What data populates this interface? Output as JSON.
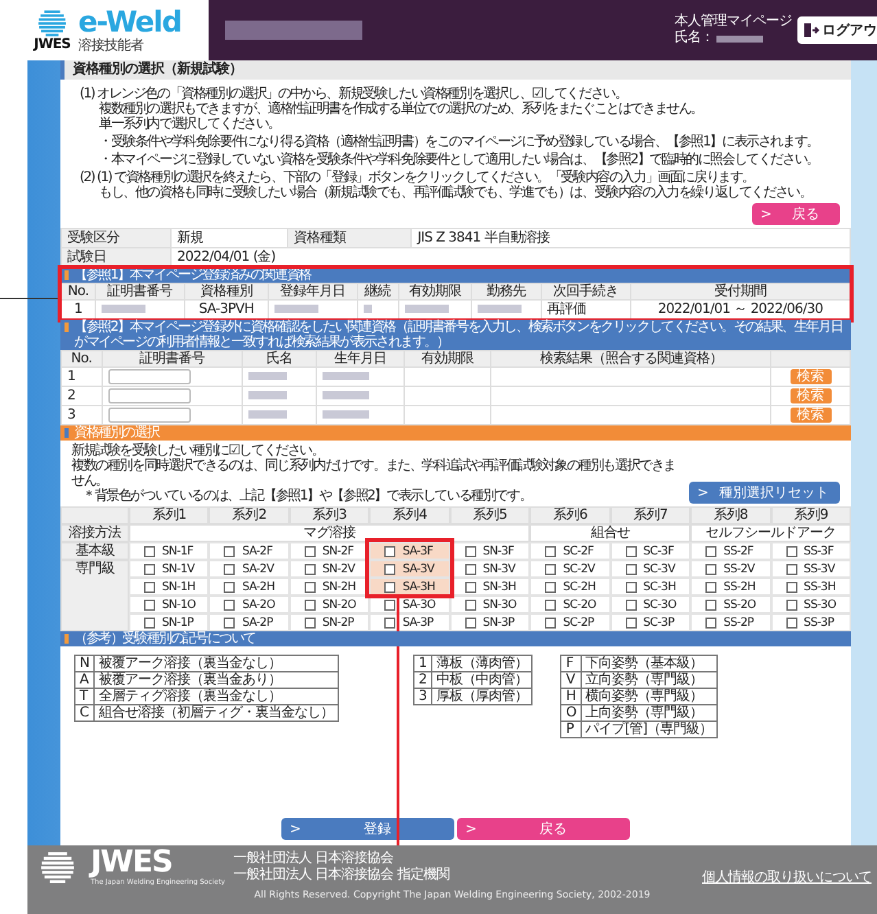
{
  "header": {
    "logo_org": "JWES",
    "logo_title": "e-Weld",
    "logo_subtitle": "溶接技能者",
    "mypage": "本人管理マイページ",
    "name_label": "氏名：",
    "logout": "ログアウ"
  },
  "section_title": "資格種別の選択（新規試験）",
  "instructions": [
    {
      "kind": "para",
      "text": "(1) オレンジ色の「資格種別の選択」の中から、新規受験したい資格種別を選択し、☑してください。"
    },
    {
      "kind": "cont",
      "text": "複数種別の選択もできますが、適格性証明書を作成する単位での選択のため、系列をまたぐことはできません。"
    },
    {
      "kind": "cont",
      "text": "単一系列内で選択してください。"
    },
    {
      "kind": "bullet",
      "text": "・受験条件や学科免除要件になり得る資格（適格性証明書）をこのマイページに予め登録している場合、【参照1】に表示されます。"
    },
    {
      "kind": "bullet",
      "text": "・本マイページに登録していない資格を受験条件や学科免除要件として適用したい場合は、【参照2】で臨時的に照会してください。"
    },
    {
      "kind": "para",
      "text": "(2) (1) で資格種別の選択を終えたら、下部の「登録」ボタンをクリックしてください。「受験内容の入力」画面に戻ります。"
    },
    {
      "kind": "cont",
      "text": "もし、他の資格も同時に受験したい場合（新規試験でも、再評価試験でも、学進でも）は、受験内容の入力を繰り返してください。"
    }
  ],
  "back_button": {
    "glyph": ">",
    "label": "戻る"
  },
  "info": [
    {
      "label": "受験区分",
      "value": "新規",
      "label2": "資格種類",
      "value2": "JIS Z 3841 半自動溶接"
    },
    {
      "label": "試験日",
      "value": "2022/04/01 (金)"
    }
  ],
  "reference1": {
    "title": "【参照1】本マイページ登録済みの関連資格",
    "columns": [
      "No.",
      "証明書番号",
      "資格種別",
      "登録年月日",
      "継続",
      "有効期限",
      "勤務先",
      "次回手続き",
      "受付期間"
    ],
    "rows": [
      [
        {
          "text": "1"
        },
        {
          "redacted": true
        },
        {
          "text": "SA-3PVH"
        },
        {
          "redacted": true
        },
        {
          "redacted": true
        },
        {
          "redacted": true
        },
        {
          "redacted": true
        },
        {
          "text": "再評価"
        },
        {
          "text": "2022/01/01 ～ 2022/06/30"
        }
      ]
    ]
  },
  "reference2": {
    "title": "【参照2】本マイページ登録外に資格確認をしたい関連資格（証明書番号を入力し、検索ボタンをクリックしてください。その結果、生年月日がマイページの利用者情報と一致すれば検索結果が表示されます。）",
    "columns": [
      "No.",
      "証明書番号",
      "氏名",
      "生年月日",
      "有効期限",
      "検索結果（照合する関連資格）"
    ],
    "rows": [
      {
        "no": "1",
        "button": "検索"
      },
      {
        "no": "2",
        "button": "検索"
      },
      {
        "no": "3",
        "button": "検索"
      }
    ]
  },
  "selection": {
    "title": "資格種別の選択",
    "notes": [
      "新規試験を受験したい種別に☑してください。",
      "複数の種別を同時選択できるのは、同じ系列内だけです。また、学科追試や再評価試験対象の種別も選択できません。",
      "＊背景色がついているのは、上記【参照1】や【参照2】で表示している種別です。"
    ],
    "reset_button": {
      "glyph": ">",
      "label": "種別選択リセット"
    },
    "method_label": "溶接方法",
    "basic_label": "基本級",
    "advanced_label": "専門級",
    "methods": [
      {
        "label": "マグ溶接",
        "series": [
          {
            "label": "系列1",
            "basic": {
              "code": "SN-1F",
              "checked": false,
              "highlighted": false
            },
            "advanced": [
              {
                "code": "SN-1V",
                "checked": false,
                "highlighted": false
              },
              {
                "code": "SN-1H",
                "checked": false,
                "highlighted": false
              },
              {
                "code": "SN-1O",
                "checked": false,
                "highlighted": false
              },
              {
                "code": "SN-1P",
                "checked": false,
                "highlighted": false
              }
            ]
          },
          {
            "label": "系列2",
            "basic": {
              "code": "SA-2F",
              "checked": false,
              "highlighted": false
            },
            "advanced": [
              {
                "code": "SA-2V",
                "checked": false,
                "highlighted": false
              },
              {
                "code": "SA-2H",
                "checked": false,
                "highlighted": false
              },
              {
                "code": "SA-2O",
                "checked": false,
                "highlighted": false
              },
              {
                "code": "SA-2P",
                "checked": false,
                "highlighted": false
              }
            ]
          },
          {
            "label": "系列3",
            "basic": {
              "code": "SN-2F",
              "checked": false,
              "highlighted": false
            },
            "advanced": [
              {
                "code": "SN-2V",
                "checked": false,
                "highlighted": false
              },
              {
                "code": "SN-2H",
                "checked": false,
                "highlighted": false
              },
              {
                "code": "SN-2O",
                "checked": false,
                "highlighted": false
              },
              {
                "code": "SN-2P",
                "checked": false,
                "highlighted": false
              }
            ]
          },
          {
            "label": "系列4",
            "basic": {
              "code": "SA-3F",
              "checked": false,
              "highlighted": true
            },
            "advanced": [
              {
                "code": "SA-3V",
                "checked": false,
                "highlighted": true
              },
              {
                "code": "SA-3H",
                "checked": false,
                "highlighted": true
              },
              {
                "code": "SA-3O",
                "checked": false,
                "highlighted": false
              },
              {
                "code": "SA-3P",
                "checked": false,
                "highlighted": false
              }
            ]
          },
          {
            "label": "系列5",
            "basic": {
              "code": "SN-3F",
              "checked": false,
              "highlighted": false
            },
            "advanced": [
              {
                "code": "SN-3V",
                "checked": false,
                "highlighted": false
              },
              {
                "code": "SN-3H",
                "checked": false,
                "highlighted": false
              },
              {
                "code": "SN-3O",
                "checked": false,
                "highlighted": false
              },
              {
                "code": "SN-3P",
                "checked": false,
                "highlighted": false
              }
            ]
          }
        ]
      },
      {
        "label": "組合せ",
        "series": [
          {
            "label": "系列6",
            "basic": {
              "code": "SC-2F",
              "checked": false,
              "highlighted": false
            },
            "advanced": [
              {
                "code": "SC-2V",
                "checked": false,
                "highlighted": false
              },
              {
                "code": "SC-2H",
                "checked": false,
                "highlighted": false
              },
              {
                "code": "SC-2O",
                "checked": false,
                "highlighted": false
              },
              {
                "code": "SC-2P",
                "checked": false,
                "highlighted": false
              }
            ]
          },
          {
            "label": "系列7",
            "basic": {
              "code": "SC-3F",
              "checked": false,
              "highlighted": false
            },
            "advanced": [
              {
                "code": "SC-3V",
                "checked": false,
                "highlighted": false
              },
              {
                "code": "SC-3H",
                "checked": false,
                "highlighted": false
              },
              {
                "code": "SC-3O",
                "checked": false,
                "highlighted": false
              },
              {
                "code": "SC-3P",
                "checked": false,
                "highlighted": false
              }
            ]
          }
        ]
      },
      {
        "label": "セルフシールドアーク",
        "series": [
          {
            "label": "系列8",
            "basic": {
              "code": "SS-2F",
              "checked": false,
              "highlighted": false
            },
            "advanced": [
              {
                "code": "SS-2V",
                "checked": false,
                "highlighted": false
              },
              {
                "code": "SS-2H",
                "checked": false,
                "highlighted": false
              },
              {
                "code": "SS-2O",
                "checked": false,
                "highlighted": false
              },
              {
                "code": "SS-2P",
                "checked": false,
                "highlighted": false
              }
            ]
          },
          {
            "label": "系列9",
            "basic": {
              "code": "SS-3F",
              "checked": false,
              "highlighted": false
            },
            "advanced": [
              {
                "code": "SS-3V",
                "checked": false,
                "highlighted": false
              },
              {
                "code": "SS-3H",
                "checked": false,
                "highlighted": false
              },
              {
                "code": "SS-3O",
                "checked": false,
                "highlighted": false
              },
              {
                "code": "SS-3P",
                "checked": false,
                "highlighted": false
              }
            ]
          }
        ]
      }
    ]
  },
  "legend": {
    "title": "（参考）受験種別の記号について",
    "tables": [
      [
        {
          "symbol": "N",
          "meaning": "被覆アーク溶接（裏当金なし）"
        },
        {
          "symbol": "A",
          "meaning": "被覆アーク溶接（裏当金あり）"
        },
        {
          "symbol": "T",
          "meaning": "全層ティグ溶接（裏当金なし）"
        },
        {
          "symbol": "C",
          "meaning": "組合せ溶接（初層ティグ・裏当金なし）"
        }
      ],
      [
        {
          "symbol": "1",
          "meaning": "薄板（薄肉管）"
        },
        {
          "symbol": "2",
          "meaning": "中板（中肉管）"
        },
        {
          "symbol": "3",
          "meaning": "厚板（厚肉管）"
        }
      ],
      [
        {
          "symbol": "F",
          "meaning": "下向姿勢（基本級）"
        },
        {
          "symbol": "V",
          "meaning": "立向姿勢（専門級）"
        },
        {
          "symbol": "H",
          "meaning": "横向姿勢（専門級）"
        },
        {
          "symbol": "O",
          "meaning": "上向姿勢（専門級）"
        },
        {
          "symbol": "P",
          "meaning": "パイプ[管]（専門級）"
        }
      ]
    ]
  },
  "actions": [
    {
      "kind": "primary",
      "glyph": ">",
      "label": "登録"
    },
    {
      "kind": "secondary",
      "glyph": ">",
      "label": "戻る"
    }
  ],
  "footer": {
    "logo": "JWES",
    "tagline": "The Japan Welding Engineering Society",
    "lines": [
      "一般社団法人 日本溶接協会",
      "一般社団法人 日本溶接協会 指定機関"
    ],
    "privacy_link": "個人情報の取り扱いについて",
    "copyright": "All Rights Reserved. Copyright The Japan Welding Engineering Society, 2002-2019"
  }
}
